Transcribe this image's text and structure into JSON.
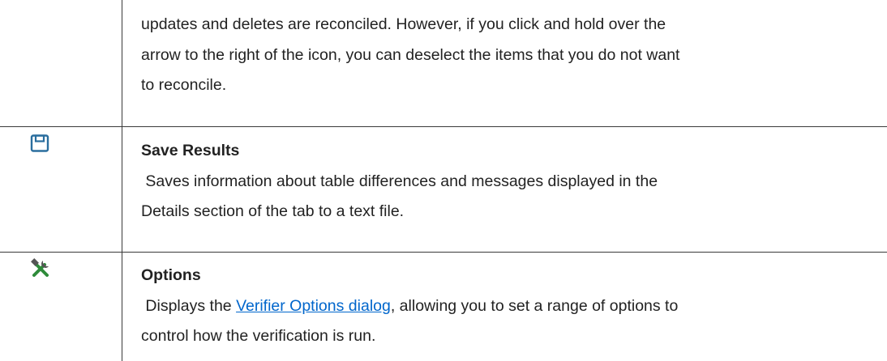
{
  "rows": [
    {
      "lines": [
        "updates and deletes are reconciled. However, if you click and hold over the",
        "arrow to the right of the icon, you can deselect the items that you do not want",
        "to reconcile."
      ]
    },
    {
      "icon": "save-icon",
      "title": "Save Results",
      "lines": [
        " Saves information about table differences and messages displayed in the",
        "Details section of the tab to a text file."
      ]
    },
    {
      "icon": "tools-icon",
      "title": "Options",
      "line1_before": " Displays the ",
      "link_text": "Verifier Options dialog",
      "line1_after": ", allowing you to set a range of options to",
      "line2": "control how the verification is run."
    }
  ],
  "colors": {
    "text": "#222222",
    "link": "#0066cc",
    "rule": "#3a3a3a",
    "save_icon": "#2a6e9e",
    "tools_icon_handle": "#2e8b3a",
    "tools_icon_metal": "#555555"
  }
}
